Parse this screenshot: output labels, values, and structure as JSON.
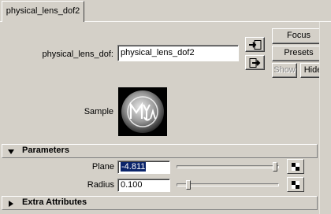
{
  "tab": {
    "label": "physical_lens_dof2"
  },
  "node": {
    "label": "physical_lens_dof:",
    "name_value": "physical_lens_dof2"
  },
  "buttons": {
    "focus": "Focus",
    "presets": "Presets",
    "show": "Show",
    "hide": "Hide"
  },
  "sample": {
    "label": "Sample",
    "icon": "maya-logo-swatch"
  },
  "sections": {
    "parameters": "Parameters",
    "extra": "Extra Attributes"
  },
  "params": {
    "plane": {
      "label": "Plane",
      "value": "-4.811",
      "slider_fraction": 0.98
    },
    "radius": {
      "label": "Radius",
      "value": "0.100",
      "slider_fraction": 0.1
    }
  },
  "colors": {
    "selection": "#0a246a",
    "background": "#d4d0c8"
  }
}
